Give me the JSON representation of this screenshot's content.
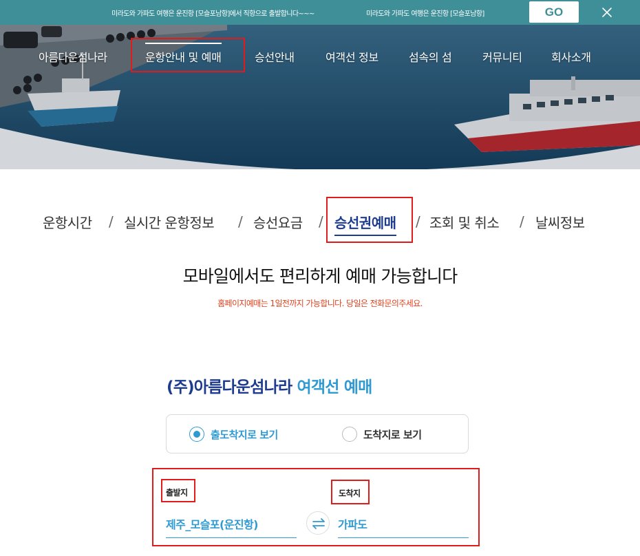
{
  "topbar": {
    "notice_1": "미라도와 가파도 여행은 운진항 [모슬포남항]에서 직항으로 출발합니다~~~",
    "notice_2": "미라도와 가파도 여행은 운진항 [모슬포남항]",
    "go_label": "GO",
    "close_icon": "close-icon"
  },
  "gnb": {
    "logo": "아름다운섬나라",
    "menu": [
      "운항안내 및 예매",
      "승선안내",
      "여객선 정보",
      "섬속의 섬",
      "커뮤니티",
      "회사소개"
    ],
    "active_menu": "운항안내 및 예매"
  },
  "subnav": {
    "items": [
      "운항시간",
      "실시간 운항정보",
      "승선요금",
      "승선권예매",
      "조회 및 취소",
      "날씨정보"
    ],
    "active": "승선권예매",
    "separator": "/"
  },
  "headline": "모바일에서도 편리하게 예매 가능합니다",
  "subline": "홈페이지예매는 1일전까지 가능합니다. 당일은 전화문의주세요.",
  "booking": {
    "title_main": "(주)아름다운섬나라",
    "title_accent": "여객선 예매",
    "view_options": [
      {
        "label": "출도착지로 보기",
        "checked": true
      },
      {
        "label": "도착지로 보기",
        "checked": false
      }
    ],
    "departure_label": "출발지",
    "departure_value": "제주_모슬포(운진항)",
    "arrival_label": "도착지",
    "arrival_value": "가파도",
    "swap_icon": "swap-arrows-icon"
  },
  "colors": {
    "topbar_bg": "#3f8f98",
    "brand_navy": "#1d3c8f",
    "accent_blue": "#2f9ad1",
    "notice_red": "#e0431f",
    "highlight_box": "#e11a1a"
  }
}
